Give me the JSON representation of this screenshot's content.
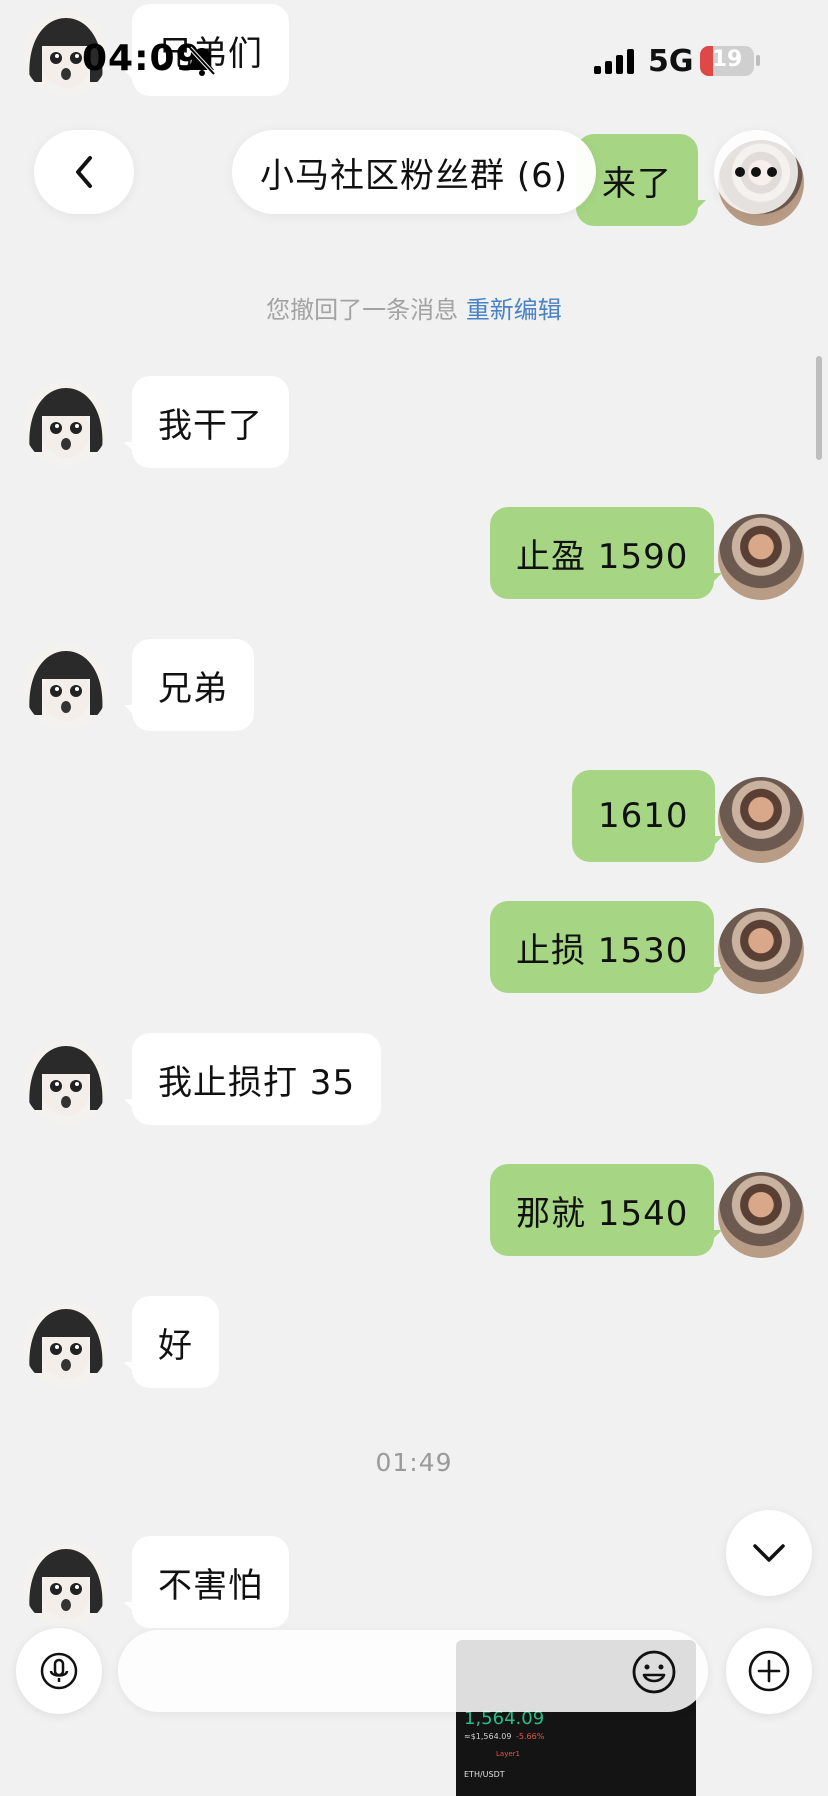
{
  "status_bar": {
    "time": "04:09",
    "network": "5G",
    "battery": "19"
  },
  "header": {
    "title": "小马社区粉丝群 (6)"
  },
  "messages": [
    {
      "side": "left",
      "text": "兄弟们"
    },
    {
      "side": "right",
      "text": "来了"
    },
    {
      "side": "left",
      "text": "我干了"
    },
    {
      "side": "right",
      "text": "止盈 1590"
    },
    {
      "side": "left",
      "text": "兄弟"
    },
    {
      "side": "right",
      "text": "1610"
    },
    {
      "side": "right",
      "text": "止损 1530"
    },
    {
      "side": "left",
      "text": "我止损打 35"
    },
    {
      "side": "right",
      "text": "那就 1540"
    },
    {
      "side": "left",
      "text": "好"
    },
    {
      "side": "left",
      "text": "不害怕"
    }
  ],
  "system": {
    "recall_text": "您撤回了一条消息",
    "reedit_link": "重新编辑"
  },
  "timestamp": "01:49",
  "thumbnail": {
    "price": "1,564.09",
    "pair": "ETH/USDT",
    "usd_price": "≈$1,564.09",
    "change": "-5.66%",
    "tag": "Layer1"
  },
  "colors": {
    "background": "#f1f1f1",
    "bubble_self": "#a6d684",
    "bubble_other": "#ffffff",
    "link": "#4a82c5",
    "battery_low": "#e04848"
  },
  "icons": {
    "back": "chevron-left-icon",
    "more": "more-dots-icon",
    "scroll_down": "chevron-down-icon",
    "voice": "microphone-icon",
    "emoji": "emoji-icon",
    "plus": "plus-icon"
  }
}
